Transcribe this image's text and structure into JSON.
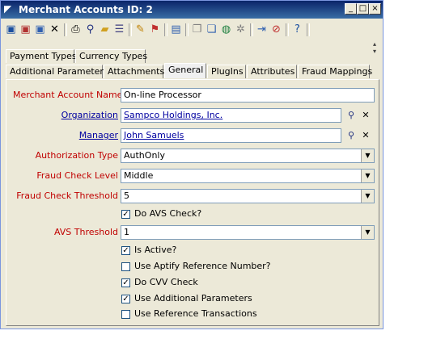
{
  "window": {
    "title": "Merchant Accounts ID: 2",
    "controls": [
      "_",
      "□",
      "×"
    ]
  },
  "toolbar": {
    "icons": [
      "save-icon",
      "save-close-icon",
      "save-new-icon",
      "delete-icon",
      "print-icon",
      "find-icon",
      "open-folder-icon",
      "list-icon",
      "wand-icon",
      "flags-icon",
      "report-icon",
      "copy-icon",
      "paste-icon",
      "globe-icon",
      "refresh-icon",
      "import-icon",
      "cancel-icon",
      "help-icon"
    ]
  },
  "tabs": {
    "row1": [
      "Payment Types",
      "Currency Types"
    ],
    "row2": [
      "Additional Parameters",
      "Attachments",
      "General",
      "PlugIns",
      "Attributes",
      "Fraud Mappings"
    ],
    "active": "General"
  },
  "form": {
    "merchant_account_name": {
      "label": "Merchant Account Name",
      "value": "On-line Processor"
    },
    "organization": {
      "label": "Organization",
      "value": "Sampco Holdings, Inc."
    },
    "manager": {
      "label": "Manager",
      "value": "John Samuels"
    },
    "authorization_type": {
      "label": "Authorization Type",
      "value": "AuthOnly"
    },
    "fraud_check_level": {
      "label": "Fraud Check Level",
      "value": "Middle"
    },
    "fraud_check_threshold": {
      "label": "Fraud Check Threshold",
      "value": "5"
    },
    "do_avs_check": {
      "label": "Do AVS Check?",
      "checked": true
    },
    "avs_threshold": {
      "label": "AVS Threshold",
      "value": "1"
    },
    "is_active": {
      "label": "Is Active?",
      "checked": true
    },
    "use_aptify_reference": {
      "label": "Use Aptify Reference Number?",
      "checked": false
    },
    "do_cvv_check": {
      "label": "Do CVV Check",
      "checked": true
    },
    "use_additional_parameters": {
      "label": "Use Additional Parameters",
      "checked": true
    },
    "use_reference_transactions": {
      "label": "Use Reference Transactions",
      "checked": false
    }
  }
}
